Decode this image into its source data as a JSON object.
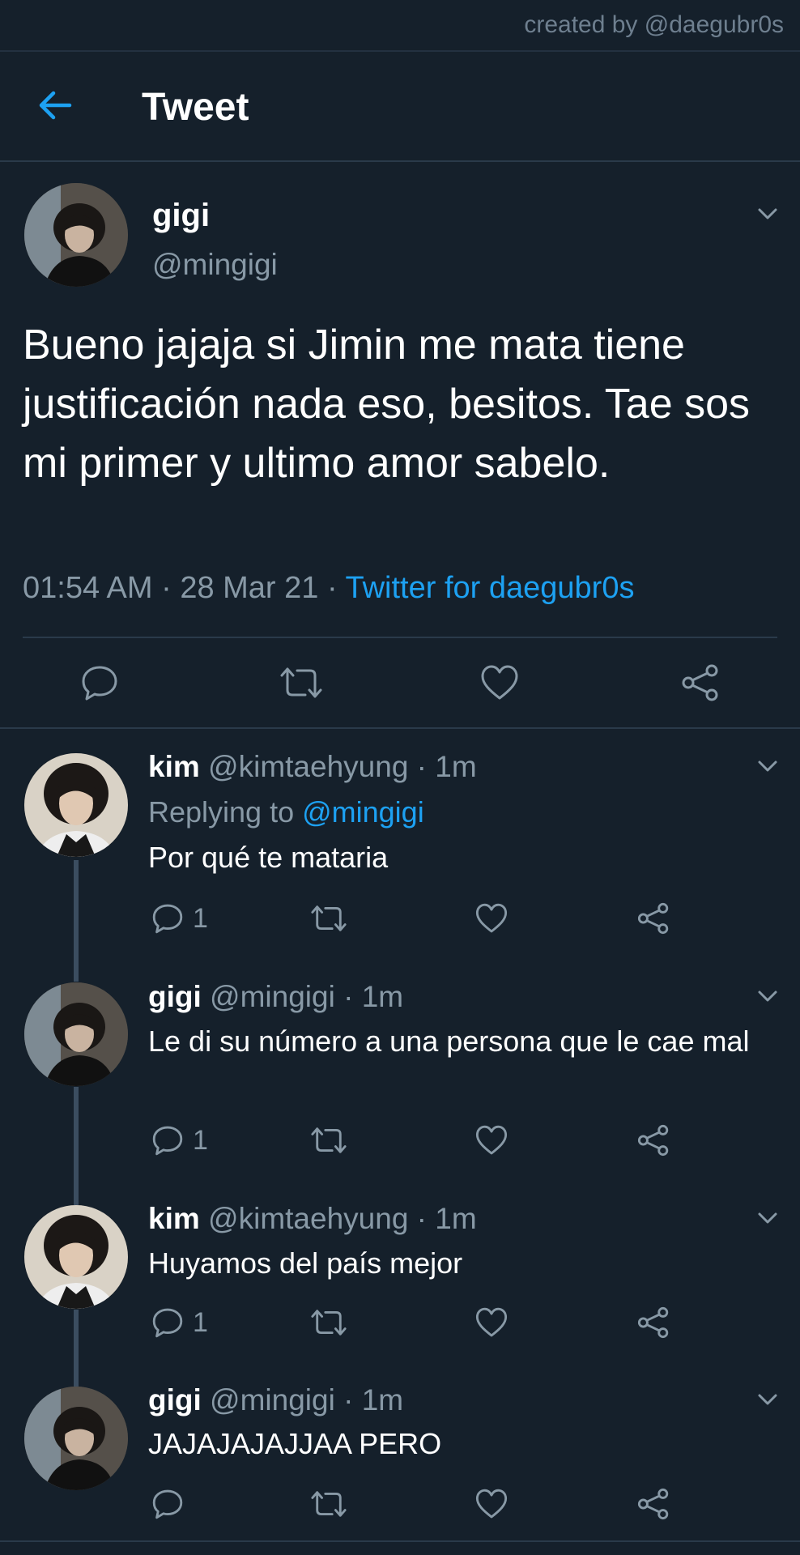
{
  "watermark": "created by @daegubr0s",
  "header": {
    "title": "Tweet",
    "back_icon": "arrow-left-icon"
  },
  "colors": {
    "background": "#15202b",
    "accent": "#1da1f2",
    "muted": "#8899a6",
    "divider": "#2a3a4a"
  },
  "main_tweet": {
    "name": "gigi",
    "handle": "@mingigi",
    "text": "Bueno jajaja si Jimin me mata tiene justificación nada eso, besitos. Tae sos mi primer y ultimo amor sabelo.",
    "time": "01:54 AM · 28 Mar 21 · ",
    "source": "Twitter for daegubr0s",
    "actions": [
      "reply-icon",
      "retweet-icon",
      "like-icon",
      "share-icon"
    ]
  },
  "replies": [
    {
      "name": "kim",
      "handle": "@kimtaehyung · 1m",
      "replying_prefix": "Replying to ",
      "replying_to": "@mingigi",
      "text": "Por qué te mataria",
      "reply_count": "1"
    },
    {
      "name": "gigi",
      "handle": "@mingigi · 1m",
      "text": "Le di su número a una persona que le cae mal",
      "reply_count": "1"
    },
    {
      "name": "kim",
      "handle": "@kimtaehyung · 1m",
      "text": "Huyamos del país mejor",
      "reply_count": "1"
    },
    {
      "name": "gigi",
      "handle": "@mingigi · 1m",
      "text": "JAJAJAJAJJAA PERO",
      "reply_count": ""
    }
  ]
}
